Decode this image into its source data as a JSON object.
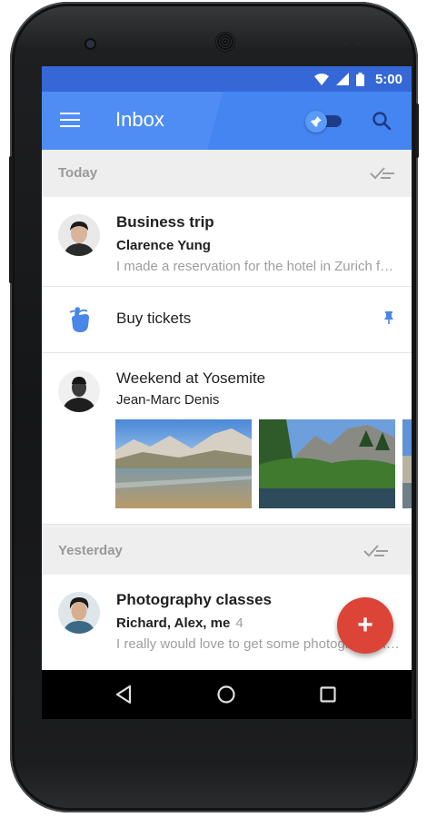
{
  "status_bar": {
    "time": "5:00",
    "icons": [
      "wifi-icon",
      "cell-signal-icon",
      "battery-icon"
    ]
  },
  "app_bar": {
    "title": "Inbox",
    "icons": [
      "menu-icon",
      "pin-icon",
      "search-icon"
    ],
    "pinned_toggle_on": true
  },
  "sections": [
    {
      "label": "Today",
      "items": [
        {
          "type": "email",
          "subject": "Business trip",
          "sender": "Clarence Yung",
          "snippet": "I made a reservation for the hotel in Zurich for the"
        },
        {
          "type": "reminder",
          "title": "Buy tickets",
          "icon": "reminder-finger-icon",
          "pinned": true
        },
        {
          "type": "email_with_photos",
          "subject": "Weekend at Yosemite",
          "sender": "Jean-Marc Denis",
          "photo_count_visible": 3
        }
      ]
    },
    {
      "label": "Yesterday",
      "items": [
        {
          "type": "email",
          "subject": "Photography classes",
          "sender": "Richard, Alex, me",
          "count": "4",
          "snippet": "I really would love to get some photography lessons"
        }
      ]
    }
  ],
  "fab": {
    "symbol": "+",
    "color": "#db4437"
  },
  "nav_bar": {
    "icons": [
      "back-icon",
      "home-icon",
      "recents-icon"
    ]
  },
  "colors": {
    "status_bar": "#3567d7",
    "app_bar": "#4f8df5",
    "section_header": "#eeeeee",
    "reminder_icon": "#4a86e8",
    "fab": "#db4437"
  }
}
